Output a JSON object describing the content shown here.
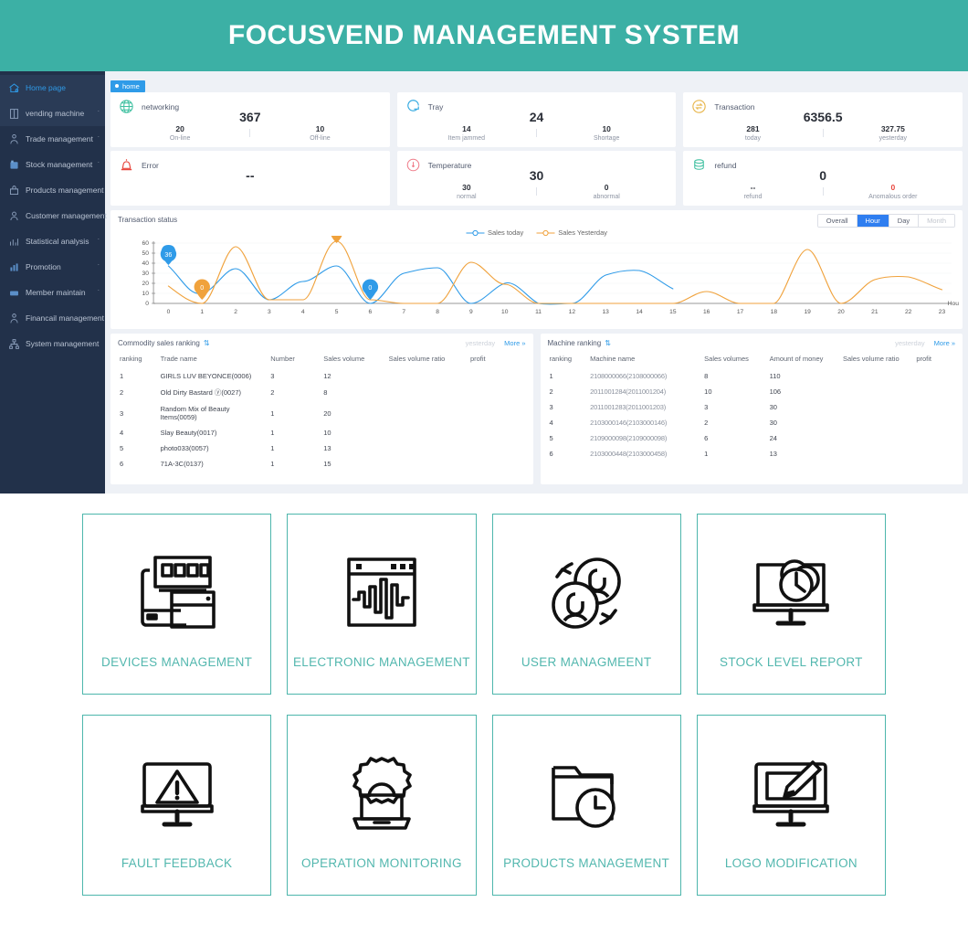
{
  "header": {
    "title": "FOCUSVEND MANAGEMENT SYSTEM",
    "bg": "#3cb0a5"
  },
  "sidebar": {
    "items": [
      {
        "label": "Home page",
        "icon": "home-icon",
        "active": true,
        "caret": ""
      },
      {
        "label": "vending machine",
        "icon": "machine-icon",
        "active": false,
        "caret": "ˇ"
      },
      {
        "label": "Trade management",
        "icon": "trade-icon",
        "active": false,
        "caret": "ˇ"
      },
      {
        "label": "Stock management",
        "icon": "stock-icon",
        "active": false,
        "caret": "ˇ"
      },
      {
        "label": "Products management",
        "icon": "products-icon",
        "active": false,
        "caret": ""
      },
      {
        "label": "Customer management",
        "icon": "customer-icon",
        "active": false,
        "caret": ""
      },
      {
        "label": "Statistical analysis",
        "icon": "statistics-icon",
        "active": false,
        "caret": "ˇ"
      },
      {
        "label": "Promotion",
        "icon": "promotion-icon",
        "active": false,
        "caret": "ˇ"
      },
      {
        "label": "Member maintain",
        "icon": "member-icon",
        "active": false,
        "caret": "ˇ"
      },
      {
        "label": "Financail management",
        "icon": "financial-icon",
        "active": false,
        "caret": ""
      },
      {
        "label": "System management",
        "icon": "system-icon",
        "active": false,
        "caret": ""
      }
    ]
  },
  "tabs": {
    "home_label": "home"
  },
  "stats": [
    {
      "title": "networking",
      "icon": "globe-icon",
      "color": "#3fc0a0",
      "big": "367",
      "left": {
        "value": "20",
        "label": "On-line"
      },
      "right": {
        "value": "10",
        "label": "Off-line"
      }
    },
    {
      "title": "Tray",
      "icon": "tray-icon",
      "color": "#31a8e0",
      "big": "24",
      "left": {
        "value": "14",
        "label": "Item jammed"
      },
      "right": {
        "value": "10",
        "label": "Shortage"
      }
    },
    {
      "title": "Transaction",
      "icon": "transaction-icon",
      "color": "#e8b64c",
      "big": "6356.5",
      "left": {
        "value": "281",
        "label": "today"
      },
      "right": {
        "value": "327.75",
        "label": "yesterday"
      }
    },
    {
      "title": "Error",
      "icon": "alarm-icon",
      "color": "#e8453c",
      "big": "--",
      "left": {
        "value": "",
        "label": ""
      },
      "right": {
        "value": "",
        "label": ""
      }
    },
    {
      "title": "Temperature",
      "icon": "thermometer-icon",
      "color": "#ef7d8a",
      "big": "30",
      "left": {
        "value": "30",
        "label": "normal"
      },
      "right": {
        "value": "0",
        "label": "abnormal"
      }
    },
    {
      "title": "refund",
      "icon": "refund-icon",
      "color": "#3fc0a0",
      "big": "0",
      "left": {
        "value": "--",
        "label": "refund"
      },
      "right": {
        "value": "0",
        "label": "Anomalous order",
        "red": true
      }
    }
  ],
  "chart_panel": {
    "title": "Transaction status",
    "range_tabs": [
      {
        "label": "Overall",
        "state": "normal"
      },
      {
        "label": "Hour",
        "state": "active"
      },
      {
        "label": "Day",
        "state": "normal"
      },
      {
        "label": "Month",
        "state": "disabled"
      }
    ],
    "axis_unit": "Hou",
    "markers": [
      {
        "value": "36",
        "series": "today",
        "x": 0,
        "color": "#2f9be8"
      },
      {
        "value": "0",
        "series": "yesterday",
        "x": 1,
        "color": "#f0a23c"
      },
      {
        "value": "59.75",
        "series": "yesterday",
        "x": 5,
        "color": "#f0a23c"
      },
      {
        "value": "0",
        "series": "today",
        "x": 6,
        "color": "#2f9be8"
      }
    ]
  },
  "chart_data": {
    "type": "line",
    "title": "Transaction status",
    "xlabel": "Hou",
    "ylabel": "",
    "xlim": [
      0,
      23
    ],
    "ylim": [
      0,
      60
    ],
    "yticks": [
      0,
      10,
      20,
      30,
      40,
      50,
      60
    ],
    "x": [
      0,
      1,
      2,
      3,
      4,
      5,
      6,
      7,
      8,
      9,
      10,
      11,
      12,
      13,
      14,
      15,
      16,
      17,
      18,
      19,
      20,
      21,
      22,
      23
    ],
    "grid": true,
    "legend_position": "top-center",
    "series": [
      {
        "name": "Sales today",
        "color": "#2f9be8",
        "values": [
          36,
          10,
          33,
          4,
          21,
          36,
          0,
          25,
          34,
          0,
          20,
          8,
          0,
          27,
          32,
          0,
          0,
          0,
          0,
          0,
          0,
          0,
          0,
          0
        ]
      },
      {
        "name": "Sales Yesterday",
        "color": "#f0a23c",
        "values": [
          17,
          0,
          56,
          4,
          4,
          59.75,
          4,
          0,
          0,
          40,
          20,
          0,
          0,
          0,
          0,
          0,
          12,
          0,
          0,
          48,
          0,
          18,
          25,
          15
        ]
      }
    ]
  },
  "commodity_table": {
    "title": "Commodity sales ranking",
    "sort_icon": "sort-icon",
    "ghost_label": "yesterday",
    "more_label": "More »",
    "columns": [
      "ranking",
      "Trade name",
      "Number",
      "Sales volume",
      "Sales volume ratio",
      "profit"
    ],
    "rows": [
      [
        "1",
        "GIRLS LUV BEYONCE(0006)",
        "3",
        "12",
        "",
        ""
      ],
      [
        "2",
        "Old Dirty Bastard ⓨ(0027)",
        "2",
        "8",
        "",
        ""
      ],
      [
        "3",
        "Random Mix of Beauty Items(0059)",
        "1",
        "20",
        "",
        ""
      ],
      [
        "4",
        "Slay Beauty(0017)",
        "1",
        "10",
        "",
        ""
      ],
      [
        "5",
        "photo033(0057)",
        "1",
        "13",
        "",
        ""
      ],
      [
        "6",
        "71A-3C(0137)",
        "1",
        "15",
        "",
        ""
      ]
    ]
  },
  "machine_table": {
    "title": "Machine ranking",
    "sort_icon": "sort-icon",
    "ghost_label": "yesterday",
    "more_label": "More »",
    "columns": [
      "ranking",
      "Machine name",
      "Sales volumes",
      "Amount of money",
      "Sales volume ratio",
      "profit"
    ],
    "rows": [
      [
        "1",
        "2108000066(2108000066)",
        "8",
        "110",
        "",
        ""
      ],
      [
        "2",
        "2011001284(2011001204)",
        "10",
        "106",
        "",
        ""
      ],
      [
        "3",
        "2011001283(2011001203)",
        "3",
        "30",
        "",
        ""
      ],
      [
        "4",
        "2103000146(2103000146)",
        "2",
        "30",
        "",
        ""
      ],
      [
        "5",
        "2109000098(2109000098)",
        "6",
        "24",
        "",
        ""
      ],
      [
        "6",
        "2103000448(2103000458)",
        "1",
        "13",
        "",
        ""
      ]
    ]
  },
  "features": {
    "accent": "#4db6ac",
    "rows": [
      [
        {
          "label": "DEVICES MANAGEMENT",
          "icon": "devices-icon"
        },
        {
          "label": "ELECTRONIC MANAGEMENT",
          "icon": "waveform-window-icon"
        },
        {
          "label": "USER MANAGMEENT",
          "icon": "users-sync-icon"
        },
        {
          "label": "STOCK LEVEL REPORT",
          "icon": "monitor-chart-icon"
        }
      ],
      [
        {
          "label": "FAULT FEEDBACK",
          "icon": "monitor-warning-icon"
        },
        {
          "label": "OPERATION MONITORING",
          "icon": "gear-laptop-icon"
        },
        {
          "label": "PRODUCTS MANAGEMENT",
          "icon": "folder-clock-icon"
        },
        {
          "label": "LOGO MODIFICATION",
          "icon": "monitor-brush-icon"
        }
      ]
    ]
  }
}
